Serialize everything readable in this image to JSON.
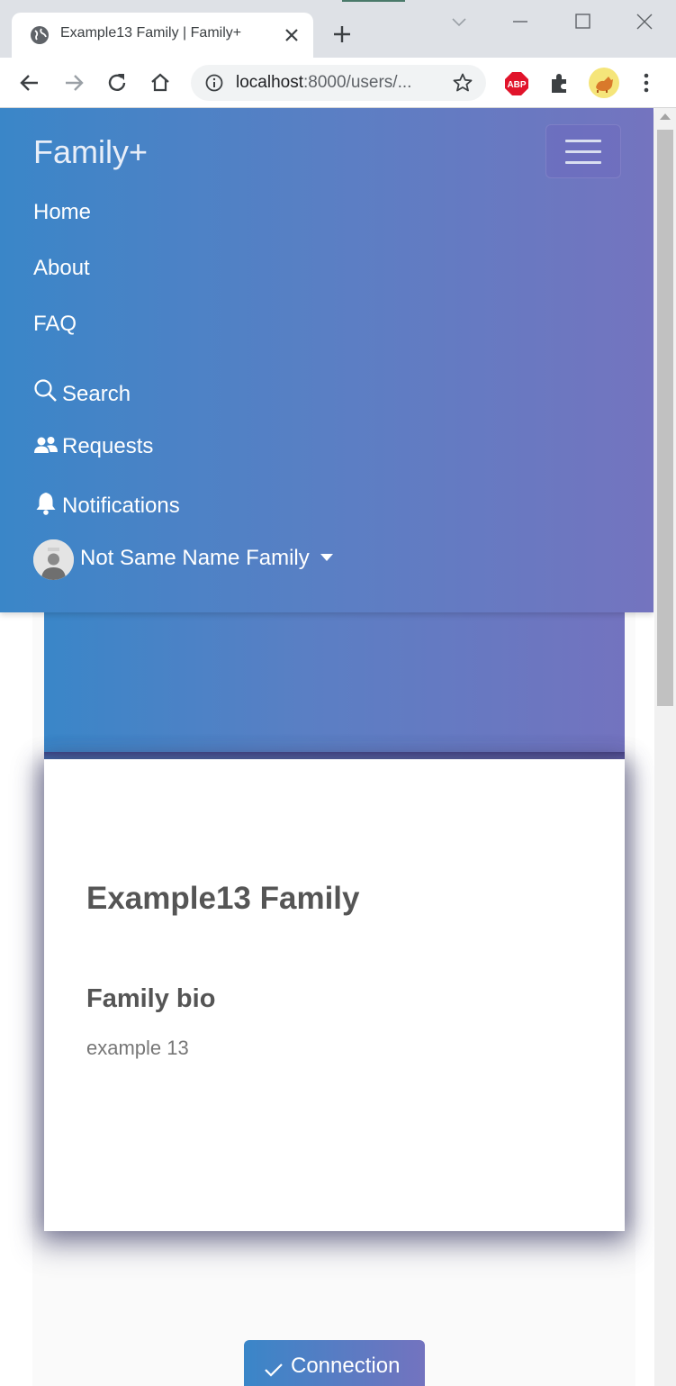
{
  "browser": {
    "tab_title": "Example13 Family | Family+",
    "url_host": "localhost",
    "url_rest": ":8000/users/..."
  },
  "navbar": {
    "brand": "Family+",
    "links": [
      "Home",
      "About",
      "FAQ"
    ],
    "search": "Search",
    "requests": "Requests",
    "notifications": "Notifications",
    "profile_name": "Not Same Name Family"
  },
  "profile": {
    "family_name": "Example13 Family",
    "bio_heading": "Family bio",
    "bio_text": "example 13"
  },
  "connection_button": "Connection",
  "colors": {
    "gradient_start": "#3a86c8",
    "gradient_end": "#7373bf",
    "tab_bg": "#dee1e6"
  }
}
